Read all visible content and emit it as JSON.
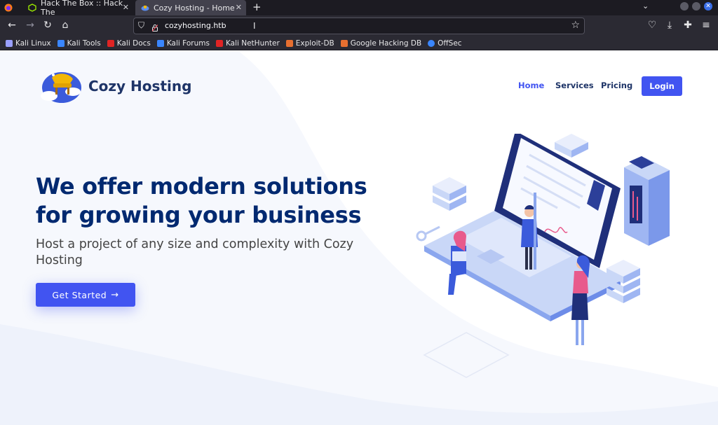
{
  "browser": {
    "tabs": [
      {
        "label": "Hack The Box :: Hack The",
        "active": false
      },
      {
        "label": "Cozy Hosting - Home",
        "active": true
      }
    ],
    "new_tab_icon": "plus-icon",
    "url": "cozyhosting.htb",
    "bookmarks": [
      {
        "label": "Kali Linux",
        "color": "#9aa0ff"
      },
      {
        "label": "Kali Tools",
        "color": "#3a86ff"
      },
      {
        "label": "Kali Docs",
        "color": "#e02424"
      },
      {
        "label": "Kali Forums",
        "color": "#3a86ff"
      },
      {
        "label": "Kali NetHunter",
        "color": "#e02424"
      },
      {
        "label": "Exploit-DB",
        "color": "#e76f30"
      },
      {
        "label": "Google Hacking DB",
        "color": "#e76f30"
      },
      {
        "label": "OffSec",
        "color": "#3a86ff"
      }
    ]
  },
  "site": {
    "brand": "Cozy Hosting",
    "nav": {
      "home": "Home",
      "services": "Services",
      "pricing": "Pricing",
      "login": "Login"
    },
    "hero": {
      "headline": "We offer modern solutions for growing your business",
      "subline": "Host a project of any size and complexity with Cozy Hosting",
      "cta": "Get Started",
      "cta_arrow": "→"
    }
  },
  "colors": {
    "accent": "#4154f1",
    "heading": "#012970",
    "nav_text": "#1e3467"
  }
}
